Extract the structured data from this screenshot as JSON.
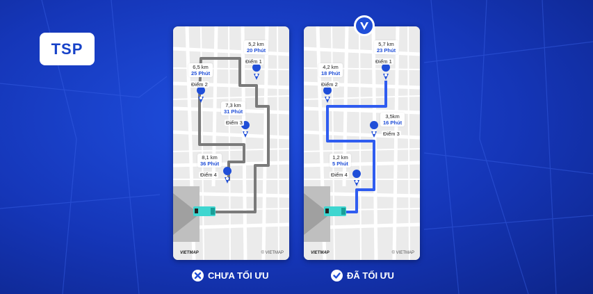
{
  "badge": {
    "label": "TSP"
  },
  "left_panel": {
    "caption": "CHƯA TỐI ƯU",
    "brand": "VIETMAP",
    "copyright": "© VIETMAP",
    "segments": [
      {
        "distance": "5,2 km",
        "time": "20 Phút",
        "point": "Điểm 1"
      },
      {
        "distance": "6,5 km",
        "time": "25 Phút",
        "point": "Điểm 2"
      },
      {
        "distance": "7,3 km",
        "time": "31 Phút",
        "point": "Điểm 3"
      },
      {
        "distance": "8,1 km",
        "time": "36 Phút",
        "point": "Điểm 4"
      }
    ]
  },
  "right_panel": {
    "caption": "ĐÃ TỐI ƯU",
    "brand": "VIETMAP",
    "copyright": "© VIETMAP",
    "segments": [
      {
        "distance": "5,7 km",
        "time": "23 Phút",
        "point": "Điểm 1"
      },
      {
        "distance": "4,2 km",
        "time": "18 Phút",
        "point": "Điểm 2"
      },
      {
        "distance": "3,5km",
        "time": "16 Phút",
        "point": "Điểm 3"
      },
      {
        "distance": "1,2 km",
        "time": "5 Phút",
        "point": "Điểm 4"
      }
    ]
  },
  "colors": {
    "background": "#1536b8",
    "route_unoptimized": "#808080",
    "route_optimized": "#2f5cf0",
    "accent": "#1f4ed8"
  },
  "icons": [
    "location-pin-icon",
    "truck-icon",
    "close-circle-icon",
    "check-circle-icon",
    "vietmap-logo-icon"
  ]
}
